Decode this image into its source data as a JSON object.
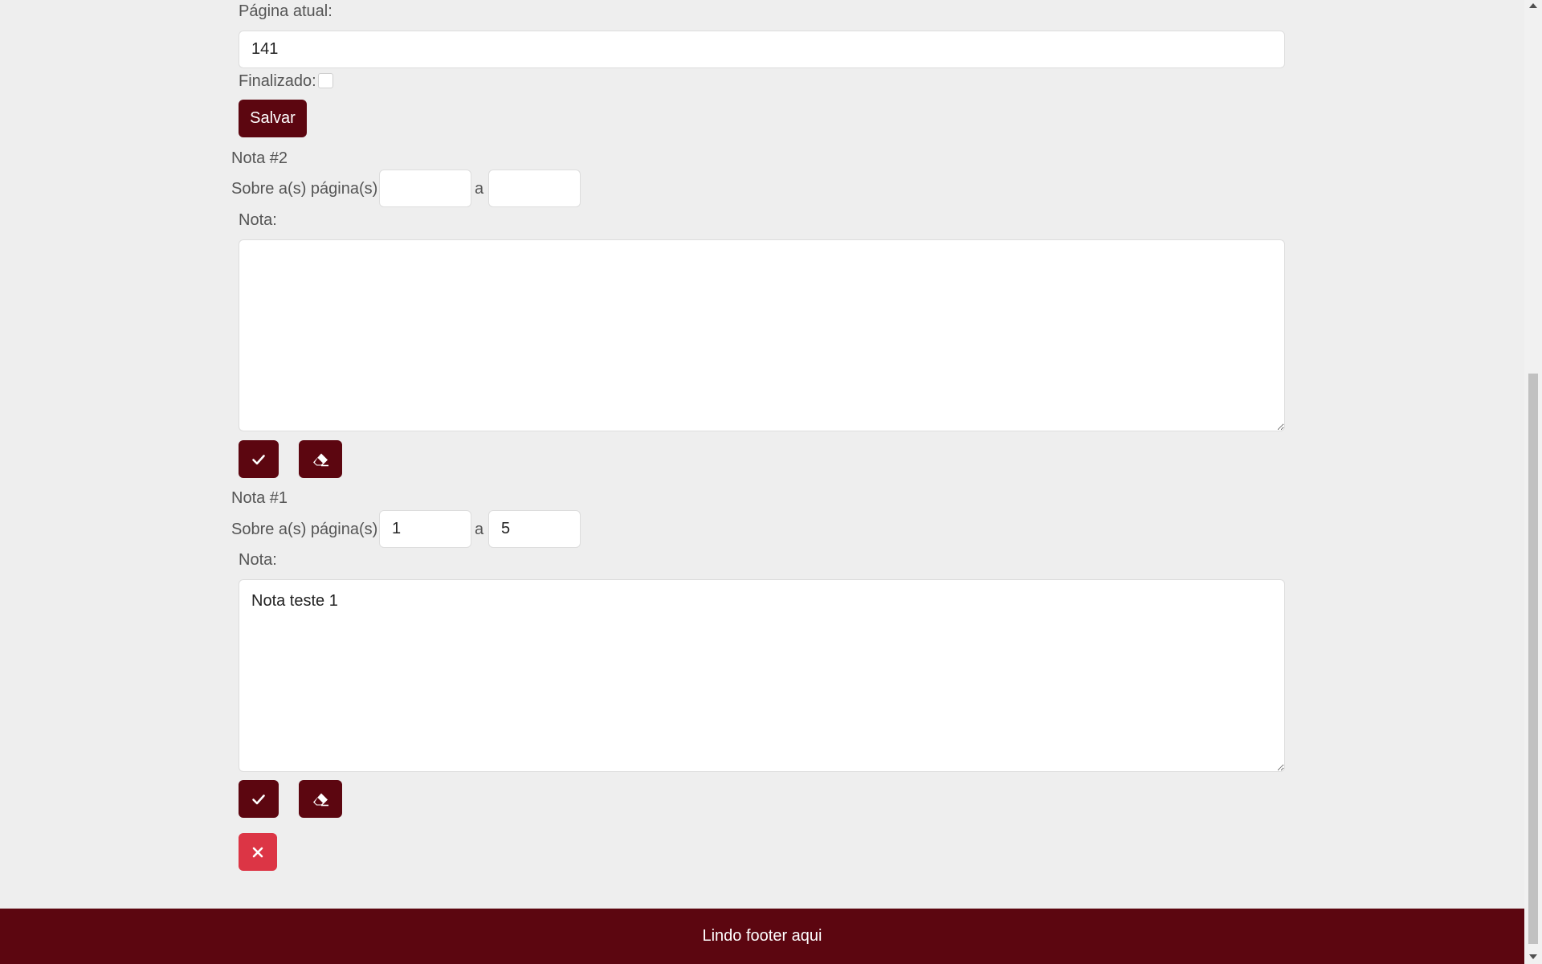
{
  "book_form": {
    "current_page_label": "Página atual:",
    "current_page_value": "141",
    "finished_label": "Finalizado:",
    "finished_checked": false,
    "save_label": "Salvar"
  },
  "notes": [
    {
      "title": "Nota #2",
      "pages_label": "Sobre a(s) página(s):",
      "from_page": "",
      "separator": "a",
      "to_page": "",
      "note_label": "Nota:",
      "note_text": ""
    },
    {
      "title": "Nota #1",
      "pages_label": "Sobre a(s) página(s):",
      "from_page": "1",
      "separator": "a",
      "to_page": "5",
      "note_label": "Nota:",
      "note_text": "Nota teste 1"
    }
  ],
  "icons": {
    "confirm": "check-icon",
    "clear": "eraser-icon",
    "delete": "close-icon"
  },
  "colors": {
    "primary": "#5c0610",
    "danger": "#dc3545",
    "background": "#eeeeee"
  },
  "footer": {
    "text": "Lindo footer aqui"
  }
}
